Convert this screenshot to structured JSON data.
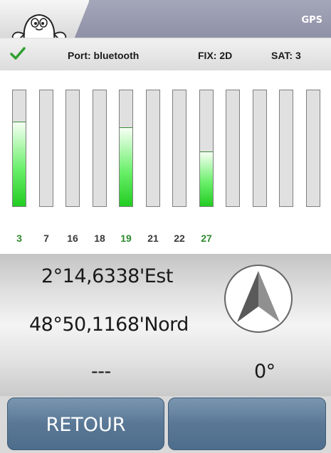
{
  "header": {
    "title": "GPS",
    "mascot_icon": "mascot-icon"
  },
  "status": {
    "port": "Port: bluetooth",
    "fix": "FIX: 2D",
    "sat": "SAT: 3",
    "ok_icon": "check-icon"
  },
  "satellites": [
    {
      "id": "3",
      "level": 0.73,
      "active": true
    },
    {
      "id": "7",
      "level": 0,
      "active": false
    },
    {
      "id": "16",
      "level": 0,
      "active": false
    },
    {
      "id": "18",
      "level": 0,
      "active": false
    },
    {
      "id": "19",
      "level": 0.68,
      "active": true
    },
    {
      "id": "21",
      "level": 0,
      "active": false
    },
    {
      "id": "22",
      "level": 0,
      "active": false
    },
    {
      "id": "27",
      "level": 0.47,
      "active": true
    },
    {
      "id": "",
      "level": 0,
      "active": false
    },
    {
      "id": "",
      "level": 0,
      "active": false
    },
    {
      "id": "",
      "level": 0,
      "active": false
    },
    {
      "id": "",
      "level": 0,
      "active": false
    }
  ],
  "position": {
    "longitude": "2°14,6338'Est",
    "latitude": "48°50,1168'Nord",
    "altitude": "---",
    "heading": "0°"
  },
  "buttons": {
    "back": "RETOUR",
    "second": ""
  },
  "colors": {
    "active_label": "#2f8a2f",
    "bar_fill": "#22cc22",
    "button": "#5a7896"
  }
}
